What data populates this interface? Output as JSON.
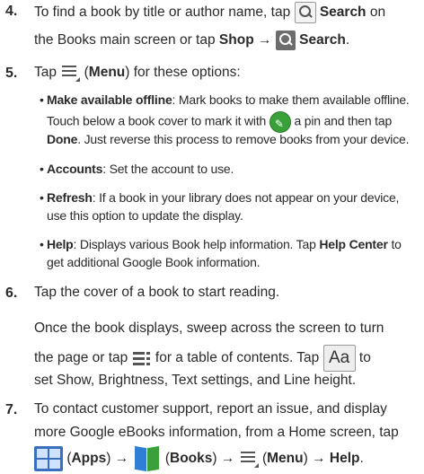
{
  "steps": [
    {
      "number": "4.",
      "line1": [
        "To find a book by title or author name, tap",
        "Search",
        "on"
      ],
      "line2": [
        "the Books main screen or tap",
        "Shop →",
        "Search",
        "."
      ]
    },
    {
      "number": "5.",
      "line1": [
        "Tap",
        "(",
        "Menu",
        ") for these options:"
      ],
      "bullets": [
        {
          "title": "Make available offline",
          "lines": [
            ": Mark books to make them available offline.",
            "Touch below a book cover to mark it with",
            "a pin and then tap",
            "Done",
            ". Just reverse this process to remove books from your device."
          ]
        },
        {
          "title": "Accounts",
          "lines": [
            ": Set the account to use."
          ]
        },
        {
          "title": "Refresh",
          "lines": [
            ": If a book in your library does not appear on your device,",
            "use this option to update the display."
          ]
        },
        {
          "title": "Help",
          "lines": [
            ": Displays various Book help information. Tap",
            "Help Center",
            "to",
            "get additional Google Book information."
          ]
        }
      ]
    },
    {
      "number": "6.",
      "line1": [
        "Tap the cover of a book to start reading."
      ],
      "para": [
        "Once the book displays, sweep across the screen to turn",
        "the page or tap",
        "for a table of contents. Tap",
        "to",
        "set Show, Brightness, Text settings, and Line height."
      ]
    },
    {
      "number": "7.",
      "lines": [
        "To contact customer support, report an issue, and display",
        "more Google eBooks information, from a Home screen, tap"
      ],
      "last": [
        "(",
        "Apps",
        ") →",
        "(",
        "Books",
        ") →",
        "(",
        "Menu",
        ") →",
        "Help",
        "."
      ]
    }
  ],
  "icons": {
    "search": "search-icon",
    "search_dark": "search-icon",
    "menu": "menu-icon",
    "pin": "pin-icon",
    "toc": "table-of-contents-icon",
    "aa": "Aa",
    "apps": "apps-icon",
    "books": "books-icon"
  },
  "colors": {
    "text": "#2a2a2a",
    "pin": "#3aa03a",
    "apps": "#3a6fbf"
  }
}
